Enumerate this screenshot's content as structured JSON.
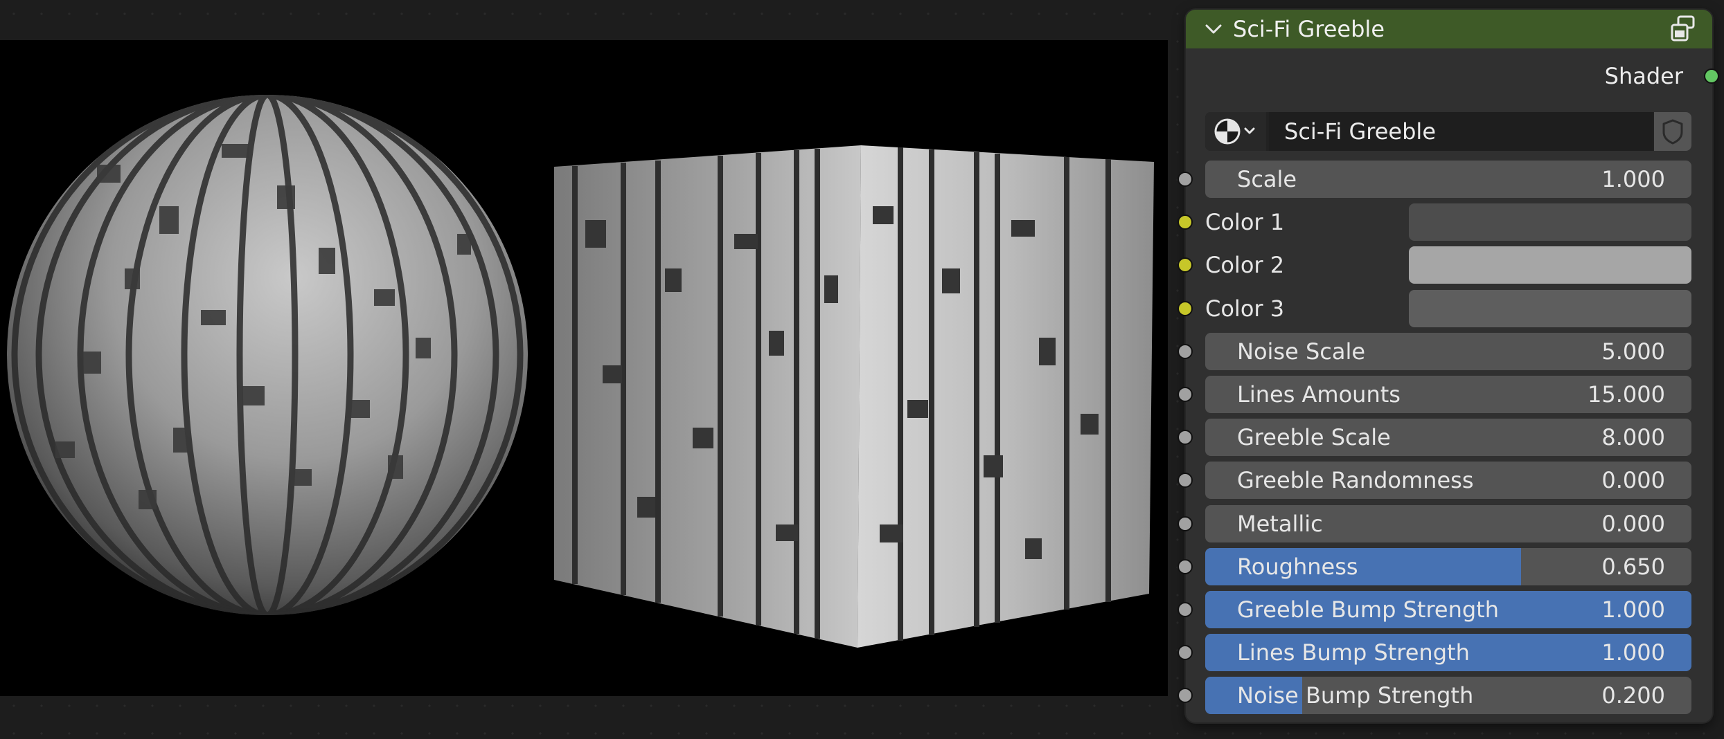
{
  "node": {
    "title": "Sci-Fi Greeble",
    "output_label": "Shader",
    "material_name": "Sci-Fi Greeble",
    "header_color": "#3e5a27",
    "field_color": "#545454",
    "slider_fill_color": "#4772b3",
    "icons": {
      "collapse": "chevron-down-icon",
      "header": "node-preview-icon",
      "material": "material-sphere-icon",
      "fake_user": "shield-icon"
    },
    "inputs": [
      {
        "label": "Scale",
        "value": "1.000",
        "kind": "number",
        "fill": 0
      },
      {
        "label": "Color 1",
        "kind": "color",
        "color": "#4d4d4d"
      },
      {
        "label": "Color 2",
        "kind": "color",
        "color": "#a6a6a6"
      },
      {
        "label": "Color 3",
        "kind": "color",
        "color": "#5e5e5e"
      },
      {
        "label": "Noise Scale",
        "value": "5.000",
        "kind": "number",
        "fill": 0
      },
      {
        "label": "Lines Amounts",
        "value": "15.000",
        "kind": "number",
        "fill": 0
      },
      {
        "label": "Greeble Scale",
        "value": "8.000",
        "kind": "number",
        "fill": 0
      },
      {
        "label": "Greeble Randomness",
        "value": "0.000",
        "kind": "number",
        "fill": 0
      },
      {
        "label": "Metallic",
        "value": "0.000",
        "kind": "number",
        "fill": 0
      },
      {
        "label": "Roughness",
        "value": "0.650",
        "kind": "slider",
        "fill": 0.65
      },
      {
        "label": "Greeble Bump Strength",
        "value": "1.000",
        "kind": "slider",
        "fill": 1.0
      },
      {
        "label": "Lines Bump Strength",
        "value": "1.000",
        "kind": "slider",
        "fill": 1.0
      },
      {
        "label": "Noise Bump Strength",
        "value": "0.200",
        "kind": "slider",
        "fill": 0.2
      }
    ]
  }
}
